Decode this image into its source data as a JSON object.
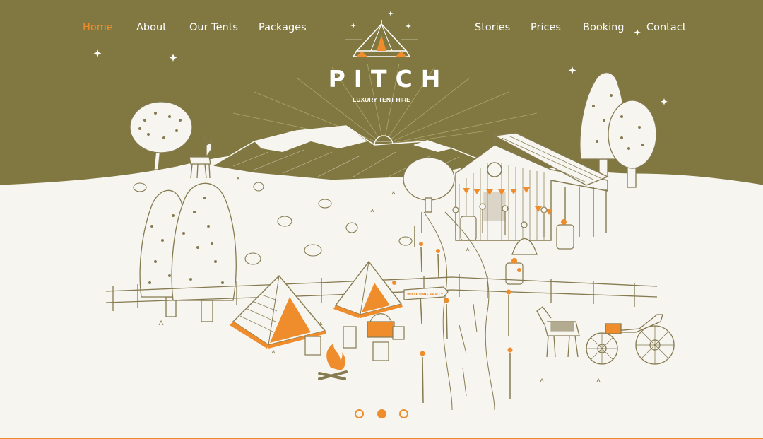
{
  "nav": {
    "left": [
      {
        "label": "Home",
        "active": true
      },
      {
        "label": "About"
      },
      {
        "label": "Our Tents"
      },
      {
        "label": "Packages"
      }
    ],
    "right": [
      {
        "label": "Stories"
      },
      {
        "label": "Prices"
      },
      {
        "label": "Booking"
      },
      {
        "label": "Contact"
      }
    ]
  },
  "brand": {
    "name": "PITCH",
    "tagline": "LUXURY TENT HIRE",
    "logo_icon": "bell-tent-moon-icon"
  },
  "hero": {
    "sign_text": "WEDDING PARTY",
    "illustration": "glamping-wedding-scene"
  },
  "slider": {
    "count": 3,
    "active_index": 1
  },
  "colors": {
    "olive": "#807840",
    "accent": "#ef8c2c",
    "ink": "#857a50",
    "paper": "#f7f5f0"
  }
}
